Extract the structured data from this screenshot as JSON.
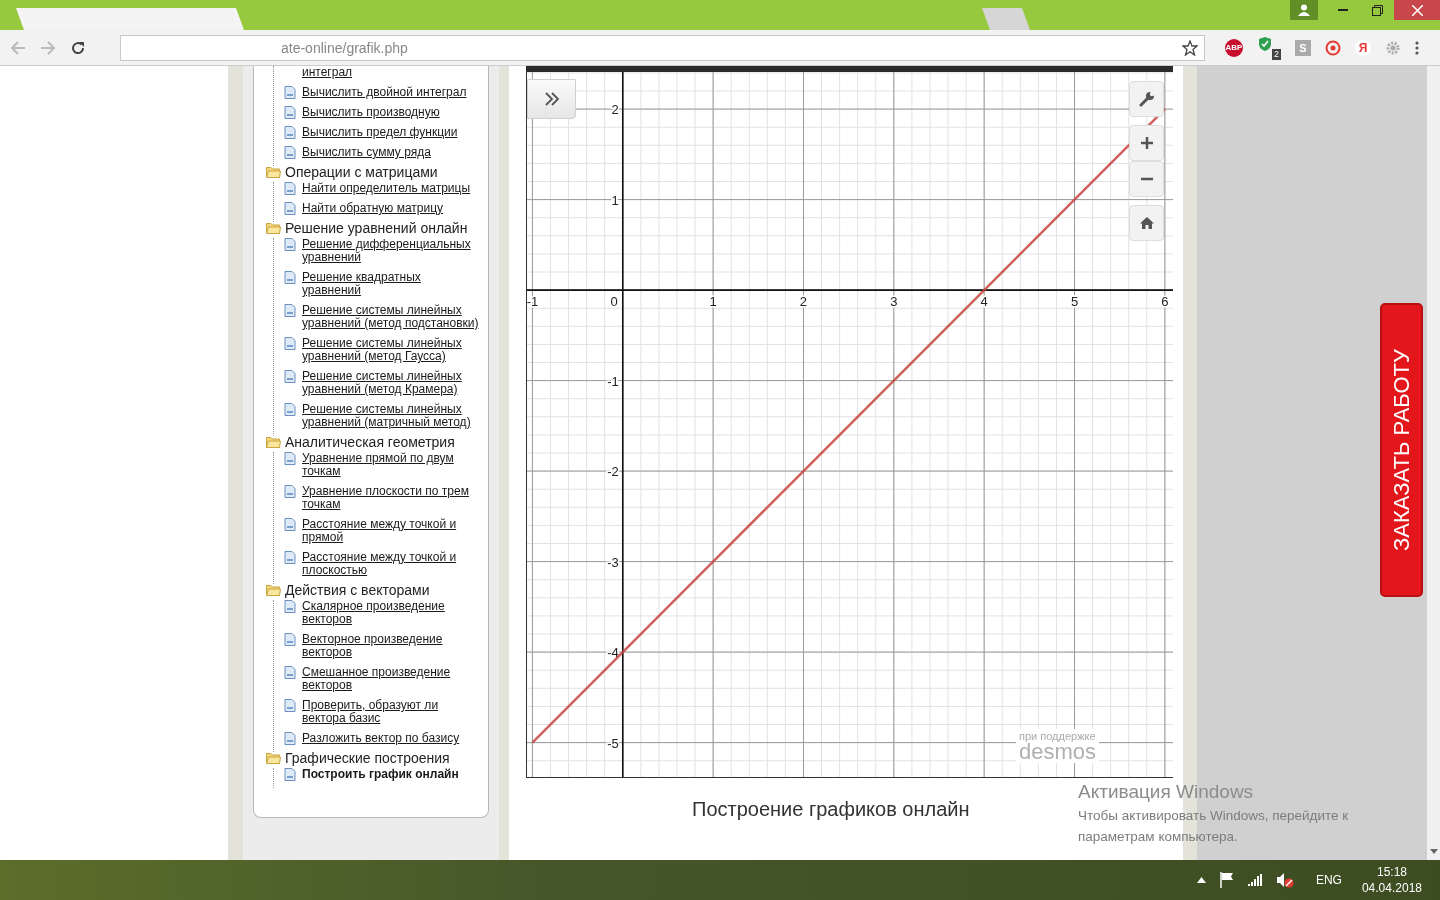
{
  "browser": {
    "address": "ate-online/grafik.php",
    "extensions": [
      {
        "kind": "abp",
        "label": "ABP"
      },
      {
        "kind": "shield",
        "label": "2"
      },
      {
        "kind": "letter",
        "label": "S"
      },
      {
        "kind": "target"
      },
      {
        "kind": "yandex",
        "label": "Я"
      },
      {
        "kind": "gear"
      }
    ]
  },
  "sidebar": {
    "lead_items": [
      {
        "label": "интеграл",
        "selected": false
      },
      {
        "label": "Вычислить двойной интеграл",
        "selected": false
      },
      {
        "label": "Вычислить производную",
        "selected": false
      },
      {
        "label": "Вычислить предел функции",
        "selected": false
      },
      {
        "label": "Вычислить сумму ряда",
        "selected": false
      }
    ],
    "groups": [
      {
        "label": "Операции с матрицами",
        "children": [
          {
            "label": "Найти определитель матрицы",
            "selected": false
          },
          {
            "label": "Найти обратную матрицу",
            "selected": false
          }
        ]
      },
      {
        "label": "Решение уравнений онлайн",
        "children": [
          {
            "label": "Решение дифференциальных уравнений",
            "selected": false
          },
          {
            "label": "Решение квадратных уравнений",
            "selected": false
          },
          {
            "label": "Решение системы линейных уравнений (метод подстановки)",
            "selected": false
          },
          {
            "label": "Решение системы линейных уравнений (метод Гаусса)",
            "selected": false
          },
          {
            "label": "Решение системы линейных уравнений (метод Крамера)",
            "selected": false
          },
          {
            "label": "Решение системы линейных уравнений (матричный метод)",
            "selected": false
          }
        ]
      },
      {
        "label": "Аналитическая геометрия",
        "children": [
          {
            "label": "Уравнение прямой по двум точкам",
            "selected": false
          },
          {
            "label": "Уравнение плоскости по трем точкам",
            "selected": false
          },
          {
            "label": "Расстояние между точкой и прямой",
            "selected": false
          },
          {
            "label": "Расстояние между точкой и плоскостью",
            "selected": false
          }
        ]
      },
      {
        "label": "Действия с векторами",
        "children": [
          {
            "label": "Скалярное произведение векторов",
            "selected": false
          },
          {
            "label": "Векторное произведение векторов",
            "selected": false
          },
          {
            "label": "Смешанное произведение векторов",
            "selected": false
          },
          {
            "label": "Проверить, образуют ли вектора базис",
            "selected": false
          },
          {
            "label": "Разложить вектор по базису",
            "selected": false
          }
        ]
      },
      {
        "label": "Графические построения",
        "children": [
          {
            "label": "Построить график онлайн",
            "selected": true
          }
        ]
      }
    ]
  },
  "chart_data": {
    "type": "line",
    "x": [
      -1,
      0,
      1,
      2,
      3,
      4,
      5,
      6
    ],
    "grid": true,
    "series": [
      {
        "color": "#c74440",
        "values": [
          -5,
          -4,
          -3,
          -2,
          -1,
          0,
          1,
          2
        ]
      }
    ],
    "xlim": [
      -1.06,
      6.09
    ],
    "ylim": [
      -5.38,
      2.41
    ],
    "xticks": [
      -1,
      0,
      1,
      2,
      3,
      4,
      5,
      6
    ],
    "yticks": [
      -5,
      -4,
      -3,
      -2,
      -1,
      1,
      2
    ]
  },
  "desmos_credit": {
    "label": "при поддержке",
    "logo": "desmos"
  },
  "caption": "Построение графиков онлайн",
  "order_button": "ЗАКАЗАТЬ РАБОТУ",
  "windows_watermark": {
    "title": "Активация Windows",
    "text": "Чтобы активировать Windows, перейдите к параметрам компьютера."
  },
  "taskbar": {
    "language": "ENG",
    "time": "15:18",
    "date": "04.04.2018"
  }
}
